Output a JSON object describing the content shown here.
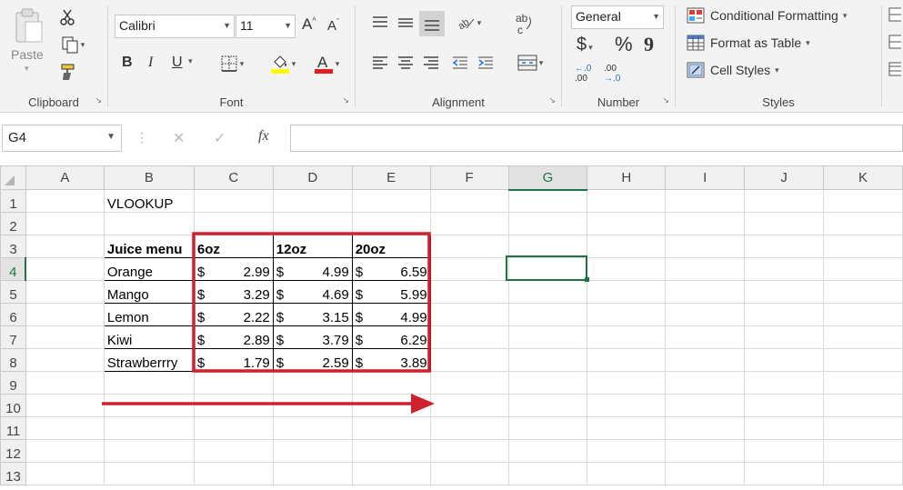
{
  "ribbon": {
    "clipboard": {
      "label": "Clipboard",
      "paste": "Paste"
    },
    "font": {
      "label": "Font",
      "name": "Calibri",
      "size": "11",
      "bold": "B",
      "italic": "I",
      "underline": "U",
      "grow": "A",
      "shrink": "A",
      "font_color": "A"
    },
    "alignment": {
      "label": "Alignment"
    },
    "number": {
      "label": "Number",
      "format": "General",
      "currency": "$",
      "percent": "%",
      "comma": "9",
      "inc_dec_top": "←.0",
      "inc_dec_bot": ".00",
      "dec_dec_top": ".00",
      "dec_dec_bot": "→.0"
    },
    "styles": {
      "label": "Styles",
      "conditional": "Conditional Formatting",
      "format_table": "Format as Table",
      "cell_styles": "Cell Styles"
    }
  },
  "formula_bar": {
    "name_box": "G4",
    "fx": "fx",
    "cancel": "✕",
    "enter": "✓",
    "formula": ""
  },
  "sheet": {
    "columns": [
      "A",
      "B",
      "C",
      "D",
      "E",
      "F",
      "G",
      "H",
      "I",
      "J",
      "K"
    ],
    "selected_cell": "G4",
    "rows": [
      {
        "n": "1",
        "b": "VLOOKUP"
      },
      {
        "n": "2"
      },
      {
        "n": "3",
        "b": "Juice menu",
        "c": "6oz",
        "d": "12oz",
        "e": "20oz"
      },
      {
        "n": "4",
        "b": "Orange",
        "c": "2.99",
        "d": "4.99",
        "e": "6.59"
      },
      {
        "n": "5",
        "b": "Mango",
        "c": "3.29",
        "d": "4.69",
        "e": "5.99"
      },
      {
        "n": "6",
        "b": "Lemon",
        "c": "2.22",
        "d": "3.15",
        "e": "4.99"
      },
      {
        "n": "7",
        "b": "Kiwi",
        "c": "2.89",
        "d": "3.79",
        "e": "6.29"
      },
      {
        "n": "8",
        "b": "Strawberrry",
        "c": "1.79",
        "d": "2.59",
        "e": "3.89"
      },
      {
        "n": "9"
      },
      {
        "n": "10"
      },
      {
        "n": "11"
      },
      {
        "n": "12"
      },
      {
        "n": "13"
      }
    ],
    "currency_symbol": "$"
  },
  "annotation": {
    "box_color": "#d0202e",
    "arrow_color": "#d0202e"
  },
  "colors": {
    "excel_green": "#217346"
  }
}
